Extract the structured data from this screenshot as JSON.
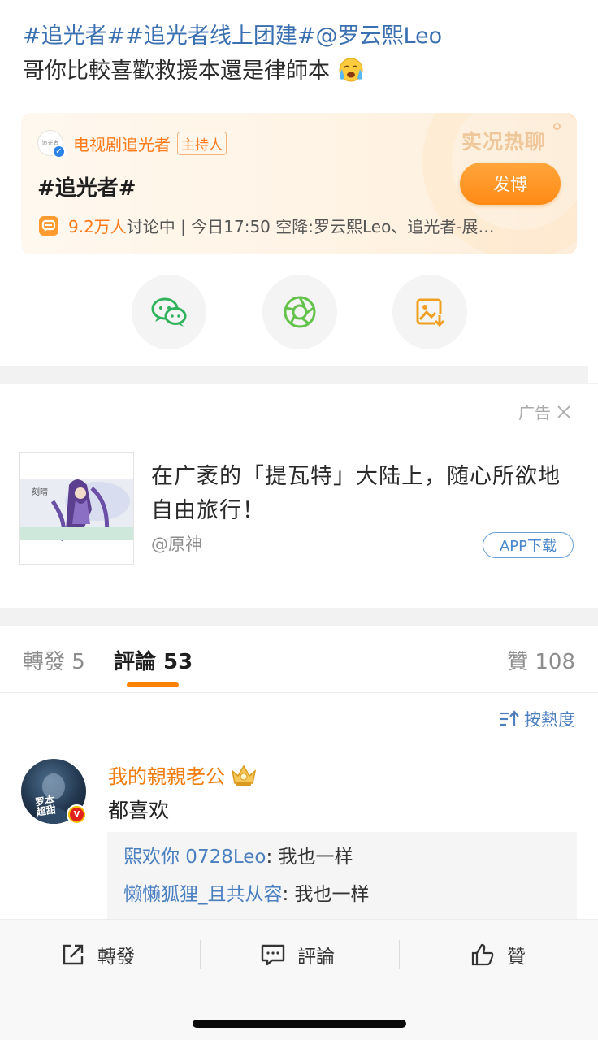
{
  "post": {
    "hashtags": "#追光者##追光者线上团建#@罗云熙Leo",
    "body": "哥你比較喜歡救援本還是律師本"
  },
  "topic_card": {
    "host_avatar_text": "追光者",
    "host_name": "电视剧追光者",
    "host_badge": "主持人",
    "title": "#追光者#",
    "live_label": "实况热聊",
    "post_button": "发博",
    "discussion_count": "9.2万人",
    "discussion_suffix": "讨论中 | 今日17:50 空降:罗云熙Leo、追光者-展…",
    "accent_color": "#ff8a15"
  },
  "share": {
    "wechat_icon": "wechat-icon",
    "moments_icon": "moments-icon",
    "save_image_icon": "save-image-icon"
  },
  "ad": {
    "label": "广告",
    "thumb_caption": "刻晴",
    "text": "在广袤的「提瓦特」大陆上，随心所欲地自由旅行！",
    "source": "@原神",
    "app_button": "APP下载"
  },
  "tabs": {
    "repost": "轉發 5",
    "comment": "評論 53",
    "like": "贊 108",
    "active_color": "#ff8200"
  },
  "sort": {
    "label": "按熱度"
  },
  "comment": {
    "avatar_text": "罗本\n超甜",
    "vip_badge": "V",
    "user": "我的親親老公",
    "text": "都喜欢",
    "replies": [
      {
        "user": "熙欢你 0728Leo",
        "text": ": 我也一样"
      },
      {
        "user": "懒懒狐狸_且共从容",
        "text": ": 我也一样"
      }
    ]
  },
  "bottom_bar": {
    "repost": "轉發",
    "comment": "評論",
    "like": "贊"
  }
}
